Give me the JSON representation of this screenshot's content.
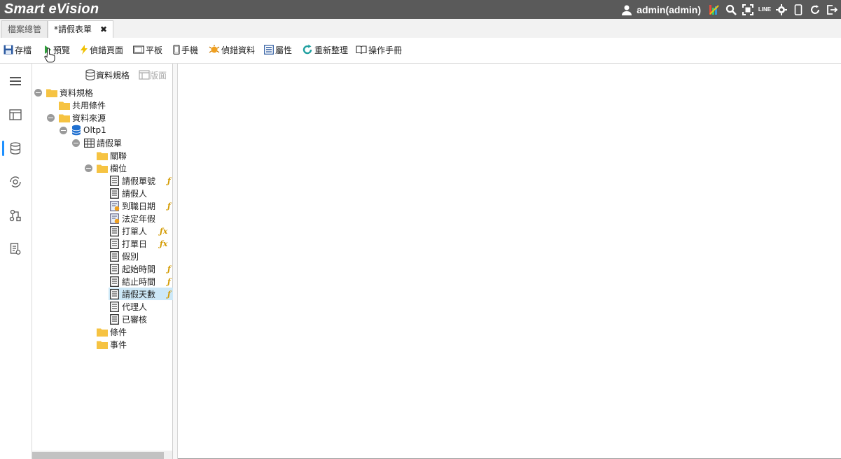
{
  "app": {
    "title": "Smart eVision",
    "user": "admin(admin)"
  },
  "header_icons": [
    "user-icon",
    "chart-icon",
    "search-icon",
    "fullscreen-icon",
    "line-icon",
    "settings-icon",
    "mobile-icon",
    "refresh-icon",
    "logout-icon"
  ],
  "header_line_text": {
    "top": "LINE",
    "bottom": ""
  },
  "tabs": [
    {
      "label": "檔案總管"
    },
    {
      "label": "*請假表單",
      "close": "✖"
    }
  ],
  "toolbar": {
    "save": "存檔",
    "preview": "預覽",
    "debug_page": "偵錯頁面",
    "tablet": "平板",
    "phone": "手機",
    "debug_data": "偵錯資料",
    "properties": "屬性",
    "reorganize": "重新整理",
    "manual": "操作手冊"
  },
  "panel": {
    "tab_data_spec": "資料規格",
    "tab_layout": "版面"
  },
  "tree": {
    "root": "資料規格",
    "shared_conditions": "共用條件",
    "data_source": "資料來源",
    "oltp": "Oltp1",
    "table": "請假單",
    "relation": "關聯",
    "fields_folder": "欄位",
    "fields": [
      {
        "label": "請假單號",
        "fx": "ƒ"
      },
      {
        "label": "請假人",
        "fx": ""
      },
      {
        "label": "到職日期",
        "fx": "ƒ"
      },
      {
        "label": "法定年假",
        "fx": ""
      },
      {
        "label": "打單人",
        "fx": "ƒx"
      },
      {
        "label": "打單日",
        "fx": "ƒx"
      },
      {
        "label": "假別",
        "fx": ""
      },
      {
        "label": "起始時間",
        "fx": "ƒ"
      },
      {
        "label": "結止時間",
        "fx": "ƒ"
      },
      {
        "label": "請假天數",
        "fx": "ƒ"
      },
      {
        "label": "代理人",
        "fx": ""
      },
      {
        "label": "已審核",
        "fx": ""
      }
    ],
    "conditions": "條件",
    "events": "事件"
  },
  "colors": {
    "header_bg": "#5a5a5a",
    "folder": "#f6c342",
    "selected_row": "#cde8f7",
    "accent": "#1e90ff"
  }
}
